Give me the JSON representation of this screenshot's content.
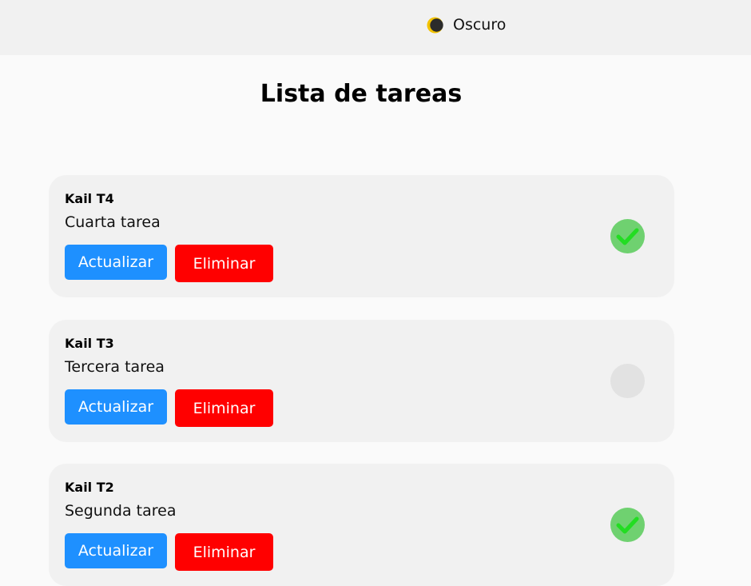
{
  "header": {
    "theme_label": "Oscuro",
    "theme_icon": "moon-icon"
  },
  "page": {
    "title": "Lista de tareas"
  },
  "tasks": [
    {
      "title": "Kail T4",
      "description": "Cuarta tarea",
      "update_label": "Actualizar",
      "delete_label": "Eliminar",
      "completed": true
    },
    {
      "title": "Kail T3",
      "description": "Tercera tarea",
      "update_label": "Actualizar",
      "delete_label": "Eliminar",
      "completed": false
    },
    {
      "title": "Kail T2",
      "description": "Segunda tarea",
      "update_label": "Actualizar",
      "delete_label": "Eliminar",
      "completed": true
    }
  ],
  "colors": {
    "update_button": "#1e90ff",
    "delete_button": "#ff0000",
    "completed": "#6fd170",
    "check": "#22dd22",
    "pending": "#e2e2e2"
  }
}
